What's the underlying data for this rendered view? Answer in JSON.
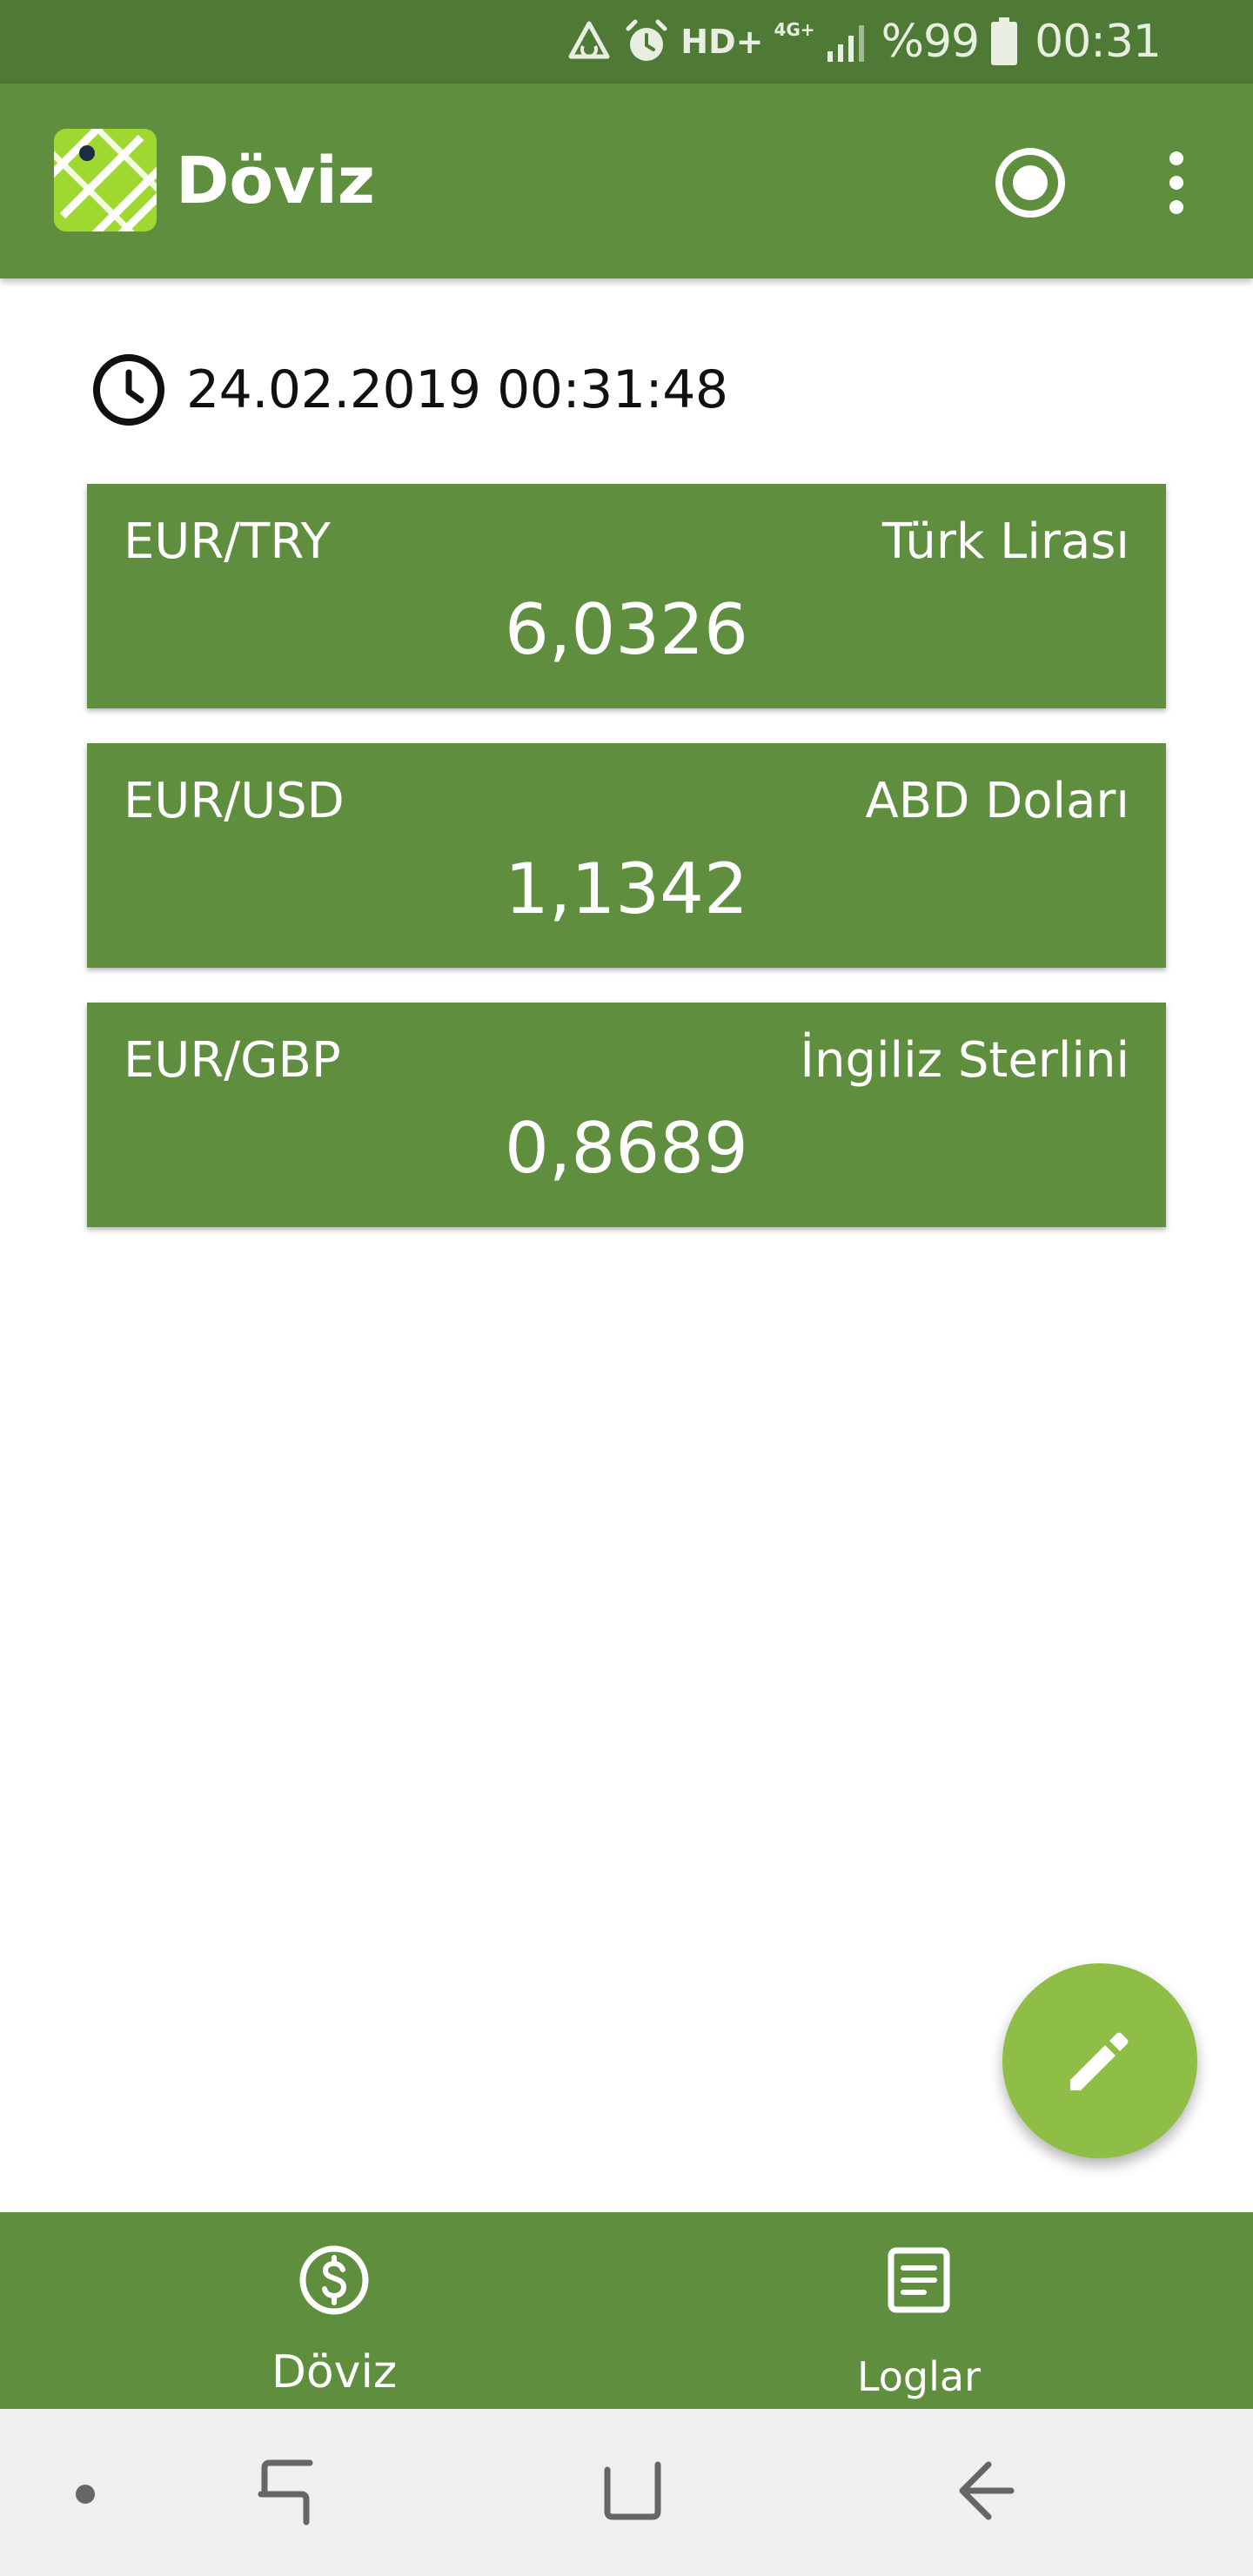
{
  "status_bar": {
    "hd_label": "HD+",
    "network": "4G+",
    "battery": "%99",
    "time": "00:31"
  },
  "app_bar": {
    "title": "Döviz",
    "icons": [
      "app-logo",
      "record-icon",
      "more-vert-icon"
    ]
  },
  "last_updated": "24.02.2019 00:31:48",
  "rates": [
    {
      "pair": "EUR/TRY",
      "currency_name": "Türk Lirası",
      "value": "6,0326"
    },
    {
      "pair": "EUR/USD",
      "currency_name": "ABD Doları",
      "value": "1,1342"
    },
    {
      "pair": "EUR/GBP",
      "currency_name": "İngiliz Sterlini",
      "value": "0,8689"
    }
  ],
  "fab": {
    "icon": "pencil-icon"
  },
  "bottom_nav": {
    "items": [
      {
        "label": "Döviz",
        "icon": "dollar-coin-icon"
      },
      {
        "label": "Loglar",
        "icon": "document-icon"
      }
    ]
  },
  "colors": {
    "status_bar": "#4e7a36",
    "primary": "#5f8e3e",
    "fab": "#8fbe46",
    "logo_green": "#9ed830",
    "system_nav": "#efefef"
  }
}
